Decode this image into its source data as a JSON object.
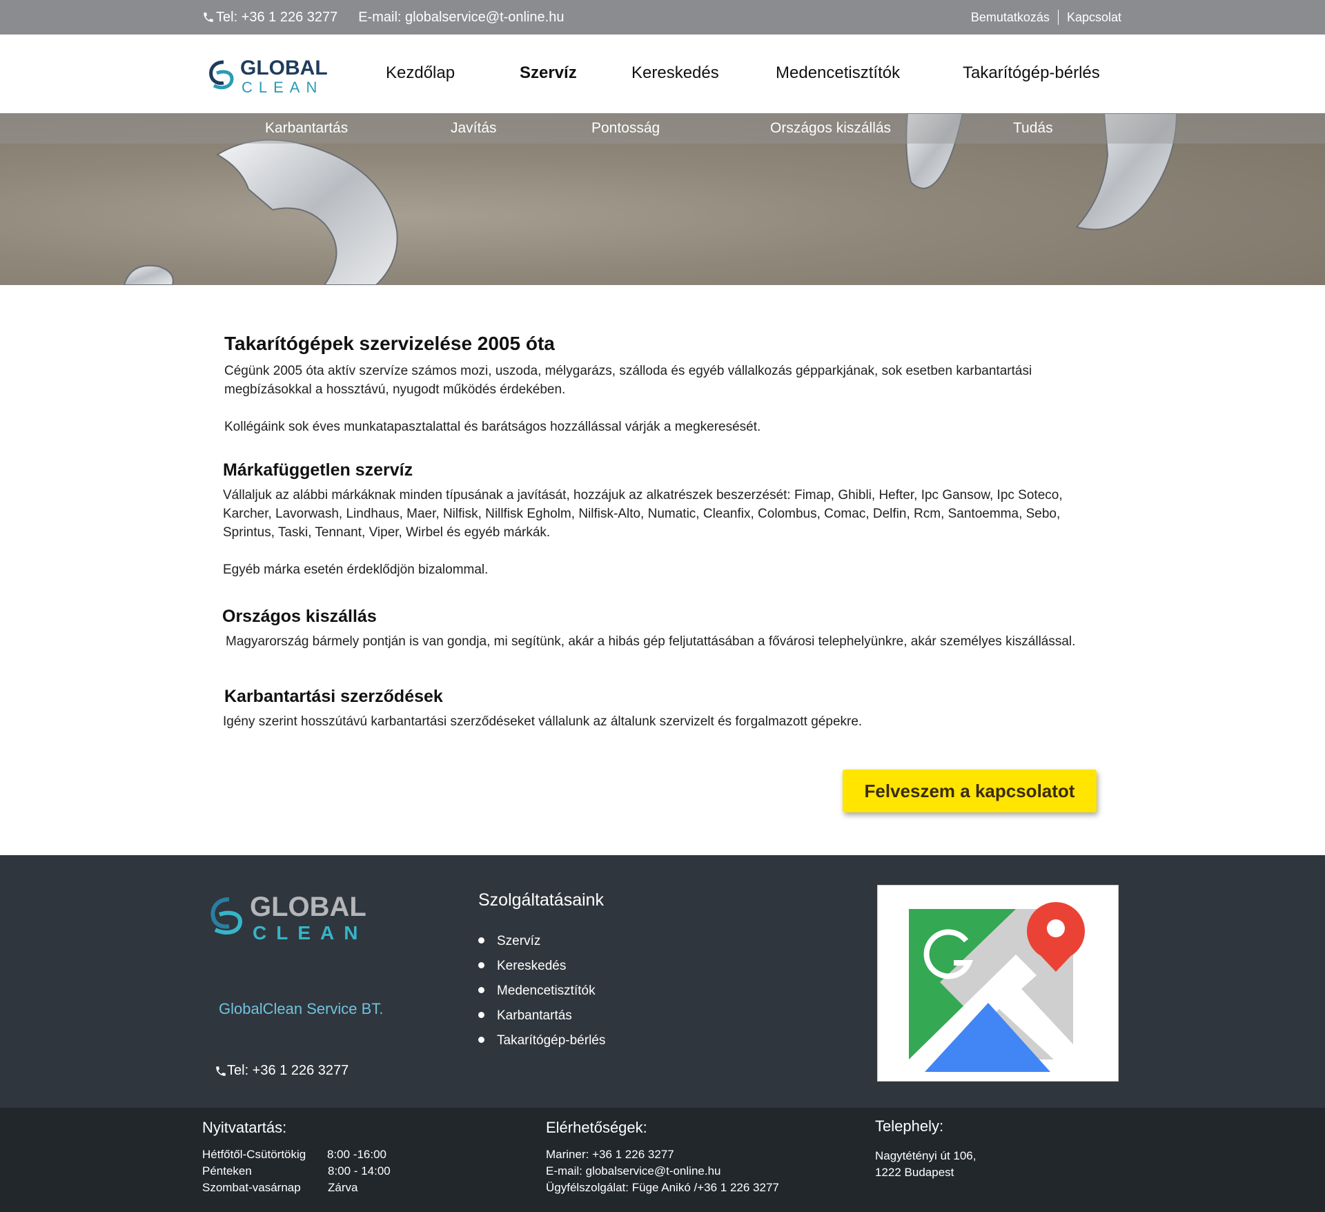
{
  "topbar": {
    "phone": "Tel: +36 1 226 3277",
    "email": "E-mail: globalservice@t-online.hu",
    "links": [
      "Bemutatkozás",
      "Kapcsolat"
    ]
  },
  "logo": {
    "line1": "GLOBAL",
    "line2": "CLEAN"
  },
  "nav": [
    "Kezdőlap",
    "Szervíz",
    "Kereskedés",
    "Medencetisztítók",
    "Takarítógép-bérlés"
  ],
  "subnav": [
    "Karbantartás",
    "Javítás",
    "Pontosság",
    "Országos kiszállás",
    "Tudás"
  ],
  "main": {
    "title": "Takarítógépek szervizelése 2005 óta",
    "intro_1": "Cégünk 2005 óta aktív szervíze számos mozi, uszoda, mélygarázs, szálloda és egyéb vállalkozás gépparkjának, sok esetben karbantartási megbízásokkal a hossztávú, nyugodt működés érdekében.",
    "intro_2": "Kollégáink sok éves munkatapasztalattal és barátságos hozzállással várják a megkeresését.",
    "brand_title": "Márkafüggetlen szervíz",
    "brand_text": "Vállaljuk az alábbi márkáknak minden típusának a javítását, hozzájuk az alkatrészek beszerzését: Fimap, Ghibli, Hefter, Ipc Gansow, Ipc Soteco, Karcher, Lavorwash, Lindhaus, Maer, Nilfisk, Nillfisk Egholm, Nilfisk-Alto, Numatic, Cleanfix, Colombus, Comac, Delfin,  Rcm, Santoemma, Sebo, Sprintus, Taski, Tennant, Viper, Wirbel és egyéb márkák.",
    "brand_text_2": "Egyéb márka esetén érdeklődjön bizalommal.",
    "delivery_title": "Országos kiszállás",
    "delivery_text": "Magyarország bármely pontján is van gondja, mi segítünk, akár a hibás gép feljutattásában a fővárosi telephelyünkre, akár személyes kiszállással.",
    "contract_title": "Karbantartási szerződések",
    "contract_text": "Igény szerint hosszútávú karbantartási szerződéseket vállalunk az általunk szervizelt és forgalmazott gépekre.",
    "cta": "Felveszem a kapcsolatot"
  },
  "footer": {
    "company": "GlobalClean Service BT.",
    "phone": "Tel: +36 1 226 3277",
    "services_title": "Szolgáltatásaink",
    "services": [
      "Szervíz",
      "Kereskedés",
      "Medencetisztítók",
      "Karbantartás",
      "Takarítógép-bérlés"
    ]
  },
  "bottom": {
    "hours_title": "Nyitvatartás:",
    "hours": [
      {
        "day": "Hétfőtől-Csütörtökig",
        "time": "8:00 -16:00"
      },
      {
        "day": "Pénteken",
        "time": "8:00 - 14:00"
      },
      {
        "day": "Szombat-vasárnap",
        "time": "Zárva"
      }
    ],
    "contacts_title": "Elérhetőségek:",
    "contacts": [
      "Mariner: +36 1 226 3277",
      "E-mail: globalservice@t-online.hu",
      "Ügyfélszolgálat: Füge Anikó /+36 1 226 3277"
    ],
    "site_title": "Telephely:",
    "site": [
      "Nagytétényi út 106,",
      "1222 Budapest"
    ]
  },
  "colors": {
    "topbar": "#8a8c8f",
    "footer": "#30363d",
    "bottombar": "#22272c",
    "cta": "#ffe500",
    "company": "#6fc3df",
    "logo_navy": "#1f3c5c",
    "logo_teal": "#2a9bb5"
  },
  "icons": [
    "phone-icon",
    "logo-icon",
    "google-maps-icon"
  ]
}
